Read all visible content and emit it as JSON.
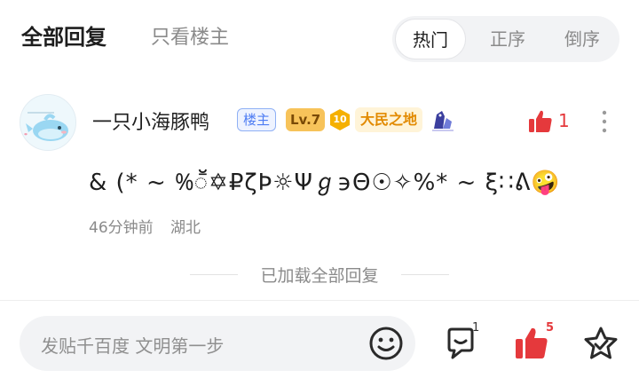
{
  "header": {
    "tab_all": "全部回复",
    "tab_owner": "只看楼主",
    "sort": {
      "hot": "热门",
      "asc": "正序",
      "desc": "倒序",
      "selected": "热门"
    }
  },
  "comment": {
    "avatar_icon": "dolphin-avatar",
    "username": "一只小海豚鸭",
    "badge_owner": "楼主",
    "badge_level": "Lv.7",
    "forum_level": "10",
    "forum_name": "大民之地",
    "text": "& (* ~ %ॕ✡₽ζϷ☼Ψℊ϶Θ☉✧%* ~ ξ∷ᕕ🤪",
    "time": "46分钟前",
    "location": "湖北",
    "like_count": "1"
  },
  "footer_note": "已加载全部回复",
  "bottom_bar": {
    "placeholder": "发贴千百度 文明第一步",
    "comment_count": "1",
    "like_count": "5"
  },
  "colors": {
    "accent_red": "#e5393c",
    "owner_blue": "#4d7cf3",
    "level_gold": "#f7c35a",
    "forum_orange": "#e28a00"
  }
}
